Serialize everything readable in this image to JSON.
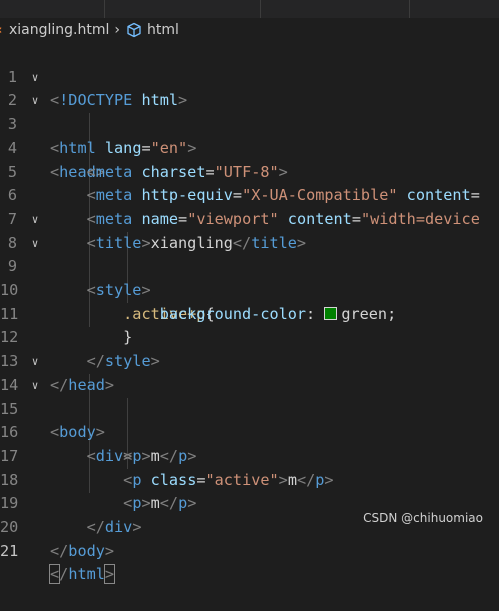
{
  "breadcrumb": {
    "file": "xiangling.html",
    "symbol": "html"
  },
  "editor": {
    "lines": [
      {
        "n": "1"
      },
      {
        "n": "2"
      },
      {
        "n": "3"
      },
      {
        "n": "4"
      },
      {
        "n": "5"
      },
      {
        "n": "6"
      },
      {
        "n": "7"
      },
      {
        "n": "8"
      },
      {
        "n": "9"
      },
      {
        "n": "10"
      },
      {
        "n": "11"
      },
      {
        "n": "12"
      },
      {
        "n": "13"
      },
      {
        "n": "14"
      },
      {
        "n": "15"
      },
      {
        "n": "16"
      },
      {
        "n": "17"
      },
      {
        "n": "18"
      },
      {
        "n": "19"
      },
      {
        "n": "20"
      },
      {
        "n": "21"
      }
    ],
    "tokens": {
      "doctype_kw": "!DOCTYPE",
      "html": "html",
      "lang": "lang",
      "en": "\"en\"",
      "head": "head",
      "meta": "meta",
      "charset": "charset",
      "utf8": "\"UTF-8\"",
      "http_equiv": "http-equiv",
      "x_ua": "\"X-UA-Compatible\"",
      "content": "content",
      "name": "name",
      "viewport": "\"viewport\"",
      "width_device": "\"width=device",
      "title": "title",
      "title_text": "xiangling",
      "style": "style",
      "selector": ".active+p",
      "prop": "background-color",
      "value": "green",
      "body": "body",
      "div": "div",
      "p": "p",
      "m": "m",
      "class": "class",
      "active": "\"active\""
    }
  },
  "colors": {
    "background": "#1e1e1e",
    "tag": "#569cd6",
    "attribute": "#9cdcfe",
    "string": "#ce9178",
    "punctuation": "#808080",
    "selector": "#d7ba7d",
    "swatch": "#008000"
  },
  "watermark": "CSDN @chihuomiao"
}
